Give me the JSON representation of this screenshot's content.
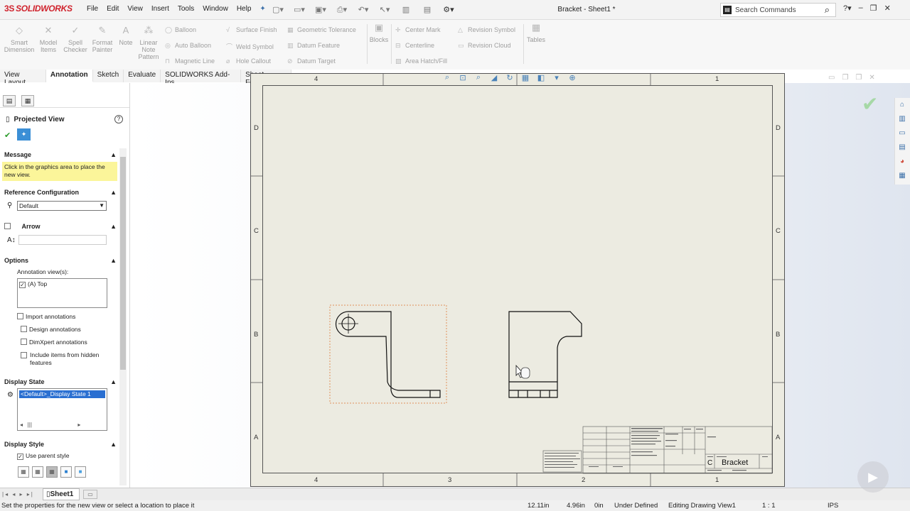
{
  "app": {
    "logo_prefix": "3S",
    "logo_text": "SOLIDWORKS",
    "document_title": "Bracket - Sheet1 *",
    "menus": [
      "File",
      "Edit",
      "View",
      "Insert",
      "Tools",
      "Window",
      "Help"
    ],
    "search": {
      "placeholder": "Search Commands"
    },
    "colors": {
      "accent": "#d0232d",
      "selection": "#2a6fd1",
      "message_bg": "#fbf59a",
      "sheet_bg": "#ecebe1",
      "view_boundary": "#e0905a"
    }
  },
  "command_manager": {
    "large": [
      {
        "label": "Smart Dimension",
        "icon": "smart-dimension-icon"
      },
      {
        "label": "Model Items",
        "icon": "model-items-icon"
      },
      {
        "label": "Spell Checker",
        "icon": "spell-checker-icon"
      },
      {
        "label": "Format Painter",
        "icon": "format-painter-icon"
      },
      {
        "label": "Note",
        "icon": "note-icon"
      },
      {
        "label": "Linear Note Pattern",
        "icon": "linear-note-pattern-icon"
      }
    ],
    "rows": [
      [
        "Balloon",
        "Auto Balloon",
        "Magnetic Line"
      ],
      [
        "Surface Finish",
        "Weld Symbol",
        "Hole Callout"
      ],
      [
        "Geometric Tolerance",
        "Datum Feature",
        "Datum Target"
      ],
      [
        "Center Mark",
        "Centerline",
        "Area Hatch/Fill"
      ],
      [
        "Revision Symbol",
        "Revision Cloud"
      ]
    ],
    "blocks_label": "Blocks",
    "tables_label": "Tables"
  },
  "tabs": [
    "View Layout",
    "Annotation",
    "Sketch",
    "Evaluate",
    "SOLIDWORKS Add-Ins",
    "Sheet Format"
  ],
  "active_tab": "Annotation",
  "property_manager": {
    "title": "Projected View",
    "message_header": "Message",
    "message_text": "Click in the graphics area to place the new view.",
    "ref_config_header": "Reference Configuration",
    "ref_config_value": "Default",
    "arrow_header": "Arrow",
    "options_header": "Options",
    "annotation_views_label": "Annotation view(s):",
    "annotation_view_item": "(A) Top",
    "checkboxes": [
      {
        "label": "Import annotations",
        "checked": false
      },
      {
        "label": "Design annotations",
        "checked": false
      },
      {
        "label": "DimXpert annotations",
        "checked": false
      },
      {
        "label": "Include items from hidden features",
        "checked": false
      }
    ],
    "display_state_header": "Display State",
    "display_state_item": "<Default>_Display State 1",
    "display_style_header": "Display Style",
    "use_parent_style": "Use parent style"
  },
  "sheet": {
    "zones_top": [
      "4",
      "3",
      "2",
      "1"
    ],
    "zones_side": [
      "D",
      "C",
      "B",
      "A"
    ],
    "title_block": {
      "size": "C",
      "name": "Bracket"
    }
  },
  "sheet_tabs": [
    "Sheet1"
  ],
  "status": {
    "prompt": "Set the properties for the new view or select a location to place it",
    "x": "12.11in",
    "y": "4.96in",
    "z": "0in",
    "state": "Under Defined",
    "editing": "Editing Drawing View1",
    "scale": "1 : 1",
    "units": "IPS"
  }
}
